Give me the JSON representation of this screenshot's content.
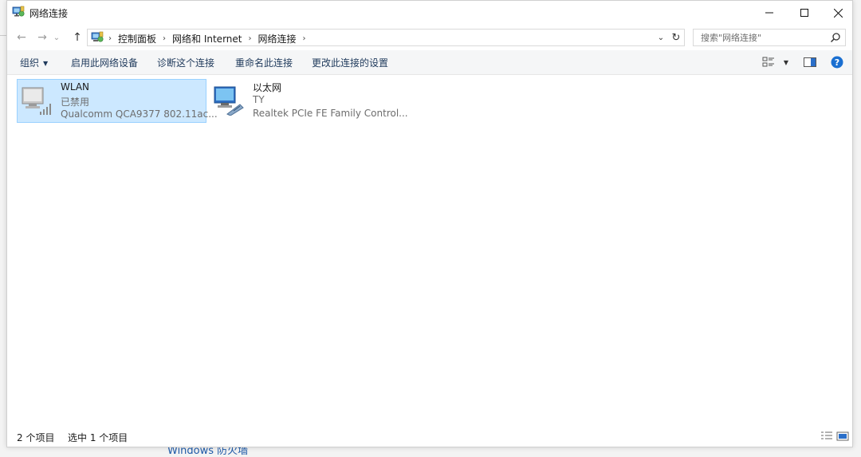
{
  "window": {
    "title": "网络连接"
  },
  "nav": {
    "back": "←",
    "forward": "→",
    "recent": "⌄",
    "up": "↑"
  },
  "address": {
    "crumbs": [
      "控制面板",
      "网络和 Internet",
      "网络连接"
    ],
    "separator": "›",
    "dropdown": "⌄",
    "refresh": "↻"
  },
  "search": {
    "placeholder": "搜索\"网络连接\"",
    "value": ""
  },
  "commands": {
    "organize": "组织",
    "enable_device": "启用此网络设备",
    "diagnose": "诊断这个连接",
    "rename": "重命名此连接",
    "change_settings": "更改此连接的设置"
  },
  "items": [
    {
      "name": "WLAN",
      "status": "已禁用",
      "device": "Qualcomm QCA9377 802.11ac...",
      "selected": true,
      "icon": "wifi-adapter-icon"
    },
    {
      "name": "以太网",
      "status": "TY",
      "device": "Realtek PCIe FE Family Control...",
      "selected": false,
      "icon": "ethernet-adapter-icon"
    }
  ],
  "statusbar": {
    "count": "2 个项目",
    "selected": "选中 1 个项目"
  },
  "behind": {
    "text": "Windows 防火墙"
  },
  "colors": {
    "selection_bg": "#cce8ff",
    "selection_border": "#99d1ff",
    "link": "#1e395b",
    "help": "#1a6fd1"
  }
}
